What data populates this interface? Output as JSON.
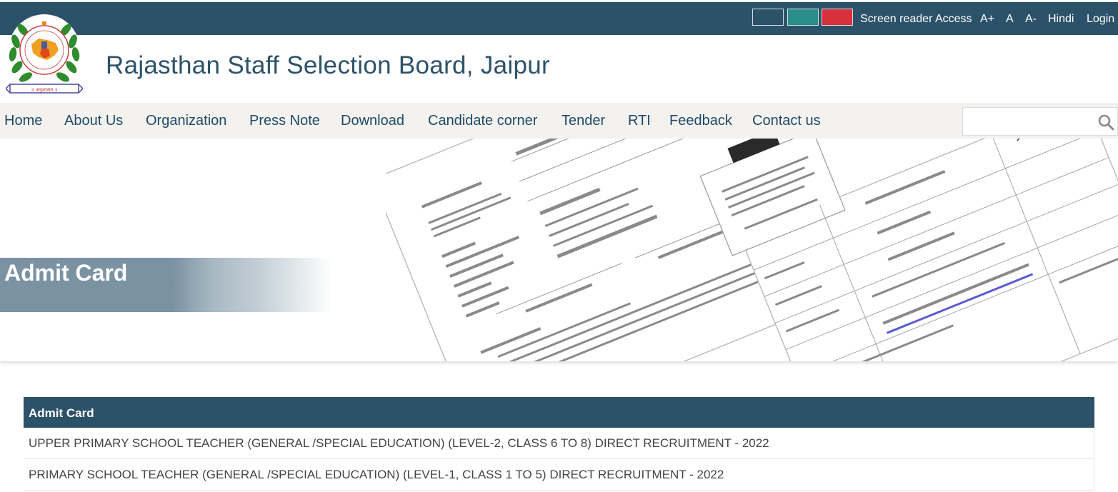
{
  "topbar": {
    "theme_swatches": [
      {
        "name": "dark-blue",
        "color": "#2c5269"
      },
      {
        "name": "teal",
        "color": "#2a8f8a"
      },
      {
        "name": "red",
        "color": "#d9303e"
      }
    ],
    "links": {
      "screen_reader": "Screen reader Access",
      "font_increase": "A+",
      "font_normal": "A",
      "font_decrease": "A-",
      "language": "Hindi",
      "login": "Login"
    }
  },
  "header": {
    "logo_icon": "rssb-emblem-icon",
    "title": "Rajasthan Staff Selection Board, Jaipur"
  },
  "nav": {
    "items": [
      {
        "label": "Home"
      },
      {
        "label": "About Us"
      },
      {
        "label": "Organization"
      },
      {
        "label": "Press Note"
      },
      {
        "label": "Download"
      },
      {
        "label": "Candidate corner"
      },
      {
        "label": "Tender"
      },
      {
        "label": "RTI"
      },
      {
        "label": "Feedback"
      },
      {
        "label": "Contact us"
      }
    ],
    "search": {
      "value": "",
      "placeholder": "",
      "icon": "search-icon"
    }
  },
  "banner": {
    "title": "Admit Card",
    "image": "admit-card-documents-illustration"
  },
  "admit_table": {
    "header": "Admit Card",
    "rows": [
      {
        "label": "UPPER PRIMARY SCHOOL TEACHER (GENERAL /SPECIAL EDUCATION) (LEVEL-2, CLASS 6 TO 8) DIRECT RECRUITMENT - 2022"
      },
      {
        "label": "PRIMARY SCHOOL TEACHER (GENERAL /SPECIAL EDUCATION) (LEVEL-1, CLASS 1 TO 5) DIRECT RECRUITMENT - 2022"
      }
    ]
  },
  "colors": {
    "brand": "#2c5269",
    "nav_bg": "#f3f2ef",
    "nav_text": "#1f4a66"
  }
}
